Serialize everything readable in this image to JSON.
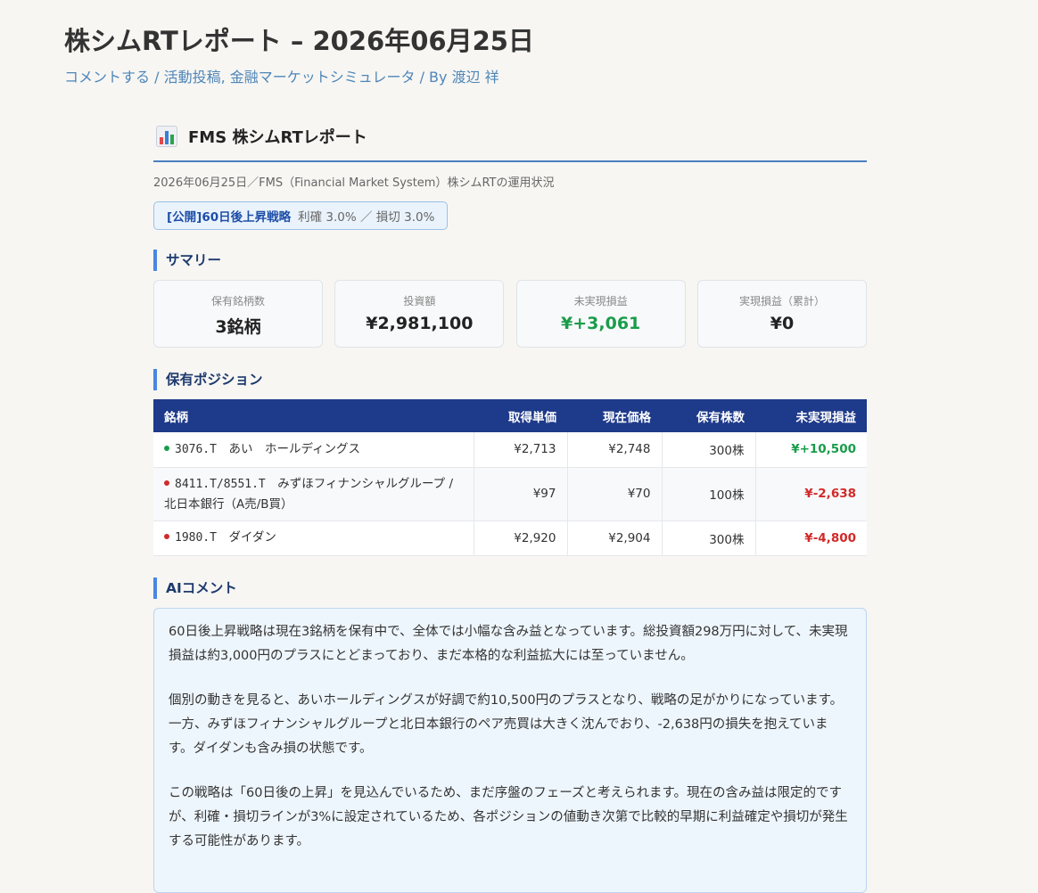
{
  "post": {
    "title": "株シムRTレポート – 2026年06月25日",
    "meta": {
      "comment_link": "コメントする",
      "separator": "/",
      "category1": "活動投稿",
      "category_sep": ", ",
      "category2": "金融マーケットシミュレータ",
      "author_label": "By",
      "author": "渡辺 祥"
    }
  },
  "report": {
    "icon": "bar-chart-icon",
    "title": "FMS 株シムRTレポート",
    "subtitle": "2026年06月25日／FMS（Financial Market System）株シムRTの運用状況",
    "strategy": {
      "name": "[公開]60日後上昇戦略",
      "params": "利確 3.0% ／ 損切 3.0%"
    },
    "summary": {
      "title": "サマリー",
      "cards": [
        {
          "label": "保有銘柄数",
          "value": "3銘柄"
        },
        {
          "label": "投資額",
          "value": "¥2,981,100"
        },
        {
          "label": "未実現損益",
          "value": "¥+3,061"
        },
        {
          "label": "実現損益（累計）",
          "value": "¥0"
        }
      ]
    },
    "positions": {
      "title": "保有ポジション",
      "headers": [
        "銘柄",
        "取得単価",
        "現在価格",
        "保有株数",
        "未実現損益"
      ],
      "rows": [
        {
          "code": "3076.T",
          "name": "あい　ホールディングス",
          "cost": "¥2,713",
          "price": "¥2,748",
          "shares": "300株",
          "pnl": "¥+10,500"
        },
        {
          "code": "8411.T/8551.T",
          "name": "みずほフィナンシャルグループ / 北日本銀行（A売/B買）",
          "cost": "¥97",
          "price": "¥70",
          "shares": "100株",
          "pnl": "¥-2,638"
        },
        {
          "code": "1980.T",
          "name": "ダイダン",
          "cost": "¥2,920",
          "price": "¥2,904",
          "shares": "300株",
          "pnl": "¥-4,800"
        }
      ]
    },
    "ai": {
      "title": "AIコメント",
      "paragraphs": [
        "60日後上昇戦略は現在3銘柄を保有中で、全体では小幅な含み益となっています。総投資額298万円に対して、未実現損益は約3,000円のプラスにとどまっており、まだ本格的な利益拡大には至っていません。",
        "個別の動きを見ると、あいホールディングスが好調で約10,500円のプラスとなり、戦略の足がかりになっています。一方、みずほフィナンシャルグループと北日本銀行のペア売買は大きく沈んでおり、-2,638円の損失を抱えています。ダイダンも含み損の状態です。",
        "この戦略は「60日後の上昇」を見込んでいるため、まだ序盤のフェーズと考えられます。現在の含み益は限定的ですが、利確・損切ラインが3%に設定されているため、各ポジションの値動き次第で比較的早期に利益確定や損切が発生する可能性があります。"
      ]
    },
    "colors": {
      "accent": "#4a7fc0",
      "table_header": "#1e3a8a",
      "positive": "#1a9c4a",
      "negative": "#d12a2a",
      "link": "#4f86b8"
    }
  }
}
